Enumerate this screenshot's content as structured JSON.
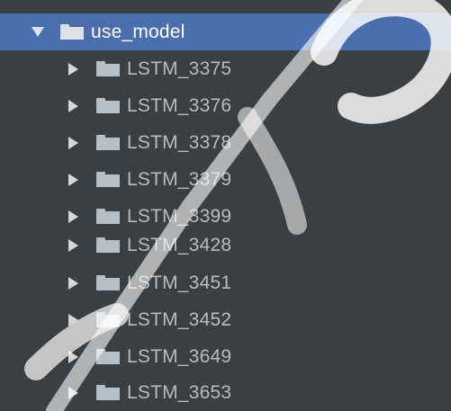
{
  "tree": {
    "root": {
      "label": "use_model",
      "icon": "folder-icon",
      "expanded": true,
      "selected": true
    },
    "children": [
      {
        "label": "LSTM_3375",
        "icon": "folder-icon",
        "expanded": false
      },
      {
        "label": "LSTM_3376",
        "icon": "folder-icon",
        "expanded": false
      },
      {
        "label": "LSTM_3378",
        "icon": "folder-icon",
        "expanded": false
      },
      {
        "label": "LSTM_3379",
        "icon": "folder-icon",
        "expanded": false
      },
      {
        "label": "LSTM_3399",
        "icon": "folder-icon",
        "expanded": false
      },
      {
        "label": "LSTM_3428",
        "icon": "folder-icon",
        "expanded": false
      },
      {
        "label": "LSTM_3451",
        "icon": "folder-icon",
        "expanded": false
      },
      {
        "label": "LSTM_3452",
        "icon": "folder-icon",
        "expanded": false
      },
      {
        "label": "LSTM_3649",
        "icon": "folder-icon",
        "expanded": false
      },
      {
        "label": "LSTM_3653",
        "icon": "folder-icon",
        "expanded": false
      }
    ]
  },
  "colors": {
    "background": "#3c3f41",
    "selection": "#4b6eaf",
    "text": "#bbbbbb",
    "selected_text": "#ffffff",
    "folder": "#b4c0c9"
  }
}
